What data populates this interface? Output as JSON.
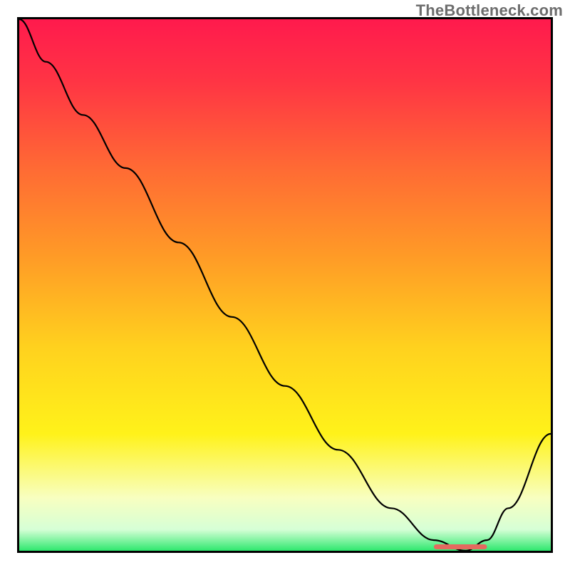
{
  "watermark": "TheBottleneck.com",
  "colors": {
    "gradient_stops": [
      {
        "offset": "0%",
        "color": "#ff1a4d"
      },
      {
        "offset": "12%",
        "color": "#ff3544"
      },
      {
        "offset": "28%",
        "color": "#ff6a34"
      },
      {
        "offset": "45%",
        "color": "#ff9c26"
      },
      {
        "offset": "62%",
        "color": "#ffd21e"
      },
      {
        "offset": "78%",
        "color": "#fff21a"
      },
      {
        "offset": "90%",
        "color": "#f8ffc0"
      },
      {
        "offset": "96%",
        "color": "#d6ffd6"
      },
      {
        "offset": "100%",
        "color": "#2ee86e"
      }
    ],
    "curve": "#000000",
    "marker": "#e46a5f",
    "frame": "#000000"
  },
  "chart_data": {
    "type": "line",
    "title": "",
    "xlabel": "",
    "ylabel": "",
    "xlim": [
      0,
      100
    ],
    "ylim": [
      0,
      100
    ],
    "grid": false,
    "legend": false,
    "annotations": [
      {
        "text": "TheBottleneck.com",
        "position": "top-right",
        "role": "watermark"
      }
    ],
    "series": [
      {
        "name": "bottleneck-curve",
        "x": [
          0,
          5,
          12,
          20,
          30,
          40,
          50,
          60,
          70,
          78,
          84,
          88,
          92,
          100
        ],
        "y": [
          100,
          92,
          82,
          72,
          58,
          44,
          31,
          19,
          8,
          2,
          0,
          2,
          8,
          22
        ]
      }
    ],
    "markers": [
      {
        "name": "optimal-band",
        "shape": "pill",
        "x_range": [
          78,
          88
        ],
        "y": 0,
        "color": "#e46a5f"
      }
    ]
  }
}
